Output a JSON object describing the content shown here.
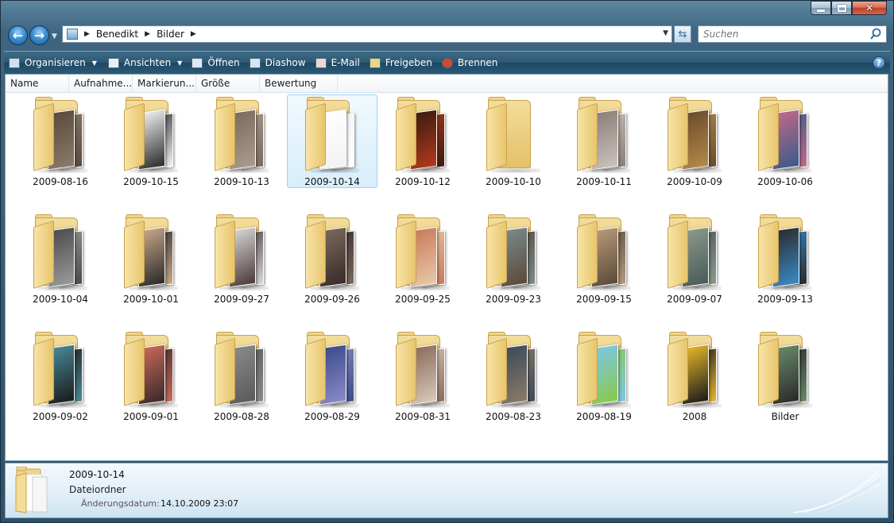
{
  "window": {
    "controls": {
      "minimize": "minimize-icon",
      "maximize": "maximize-icon",
      "close": "close-icon"
    }
  },
  "nav": {
    "back_icon": "back-arrow-icon",
    "forward_icon": "forward-arrow-icon",
    "breadcrumb": [
      "Benedikt",
      "Bilder"
    ],
    "search_placeholder": "Suchen"
  },
  "toolbar": {
    "items": [
      {
        "label": "Organisieren",
        "icon": "organize-icon",
        "has_dropdown": true
      },
      {
        "label": "Ansichten",
        "icon": "views-icon",
        "has_dropdown": true
      },
      {
        "label": "Öffnen",
        "icon": "open-icon"
      },
      {
        "label": "Diashow",
        "icon": "slideshow-icon"
      },
      {
        "label": "E-Mail",
        "icon": "email-icon"
      },
      {
        "label": "Freigeben",
        "icon": "share-icon"
      },
      {
        "label": "Brennen",
        "icon": "burn-icon"
      }
    ],
    "help_label": "?"
  },
  "columns": [
    "Name",
    "Aufnahme...",
    "Markierun...",
    "Größe",
    "Bewertung"
  ],
  "folders": [
    {
      "name": "2009-08-16",
      "c1": "#5a4a3c",
      "c2": "#8a7a6a"
    },
    {
      "name": "2009-10-15",
      "c1": "#f3f3f3",
      "c2": "#2b2b2b"
    },
    {
      "name": "2009-10-13",
      "c1": "#7d6a5c",
      "c2": "#a89b8e"
    },
    {
      "name": "2009-10-14",
      "c1": "#ffffff",
      "c2": "#f2f2f2",
      "selected": true
    },
    {
      "name": "2009-10-12",
      "c1": "#3a1a12",
      "c2": "#b23a1a"
    },
    {
      "name": "2009-10-10",
      "c1": "#f0d58a",
      "c2": "#f0d58a"
    },
    {
      "name": "2009-10-11",
      "c1": "#8a7e76",
      "c2": "#c9c2bc"
    },
    {
      "name": "2009-10-09",
      "c1": "#6a4a2a",
      "c2": "#b38a4a"
    },
    {
      "name": "2009-10-06",
      "c1": "#c06a88",
      "c2": "#3a5a8a"
    },
    {
      "name": "2009-10-04",
      "c1": "#4a4a4a",
      "c2": "#9a9a9a"
    },
    {
      "name": "2009-10-01",
      "c1": "#c8a88a",
      "c2": "#2a2a2a"
    },
    {
      "name": "2009-09-27",
      "c1": "#d8d8d8",
      "c2": "#4a3a3a"
    },
    {
      "name": "2009-09-26",
      "c1": "#7a6a5a",
      "c2": "#3a2a2a"
    },
    {
      "name": "2009-09-25",
      "c1": "#c87a5a",
      "c2": "#e8c8a8"
    },
    {
      "name": "2009-09-23",
      "c1": "#7a8a8a",
      "c2": "#5a4a3a"
    },
    {
      "name": "2009-09-15",
      "c1": "#b89a7a",
      "c2": "#5a4a3a"
    },
    {
      "name": "2009-09-07",
      "c1": "#8a9a8a",
      "c2": "#4a5a5a"
    },
    {
      "name": "2009-09-13",
      "c1": "#2a2a2a",
      "c2": "#3a8ac8"
    },
    {
      "name": "2009-09-02",
      "c1": "#4a8a9a",
      "c2": "#1a1a1a"
    },
    {
      "name": "2009-09-01",
      "c1": "#c86a5a",
      "c2": "#3a2a2a"
    },
    {
      "name": "2009-08-28",
      "c1": "#8a8a8a",
      "c2": "#5a5a5a"
    },
    {
      "name": "2009-08-29",
      "c1": "#3a4a8a",
      "c2": "#8a8ac8"
    },
    {
      "name": "2009-08-31",
      "c1": "#8a6a5a",
      "c2": "#d8c8b8"
    },
    {
      "name": "2009-08-23",
      "c1": "#3a4a5a",
      "c2": "#8a7a6a"
    },
    {
      "name": "2009-08-19",
      "c1": "#7ac8e8",
      "c2": "#8ac84a"
    },
    {
      "name": "2008",
      "c1": "#e8b82a",
      "c2": "#1a1a1a"
    },
    {
      "name": "Bilder",
      "c1": "#6a8a6a",
      "c2": "#2a2a2a"
    }
  ],
  "details": {
    "name": "2009-10-14",
    "type": "Dateiordner",
    "date_label": "Änderungsdatum:",
    "date_value": "14.10.2009 23:07"
  }
}
